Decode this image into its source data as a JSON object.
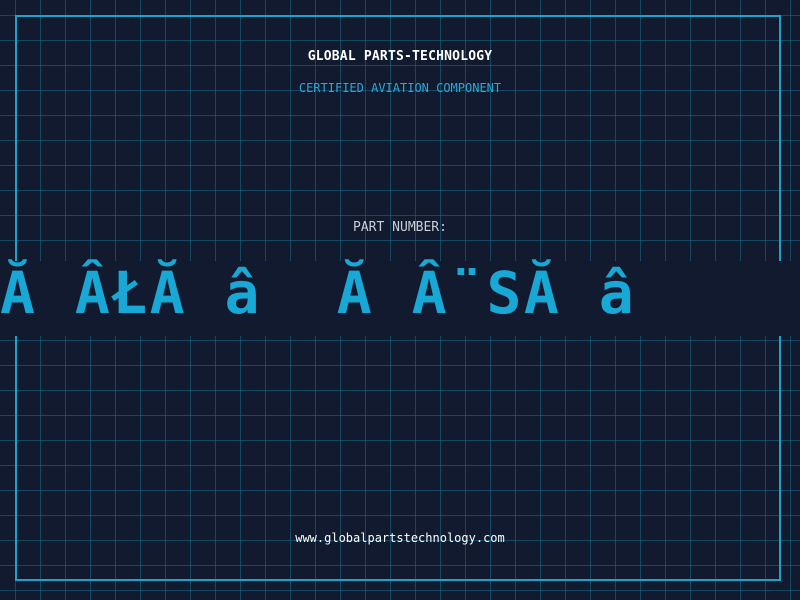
{
  "header": {
    "company_name": "GLOBAL PARTS-TECHNOLOGY",
    "subtitle": "CERTIFIED AVIATION COMPONENT"
  },
  "part": {
    "label": "PART NUMBER:",
    "value": "Ă ÂŁĂ â  Ă Â¨SĂ â"
  },
  "footer": {
    "website": "www.globalpartstechnology.com"
  },
  "colors": {
    "background": "#111a2e",
    "grid": "#186e8c",
    "frame": "#1da3c9",
    "accent": "#18a8d6",
    "text": "#ffffff"
  }
}
